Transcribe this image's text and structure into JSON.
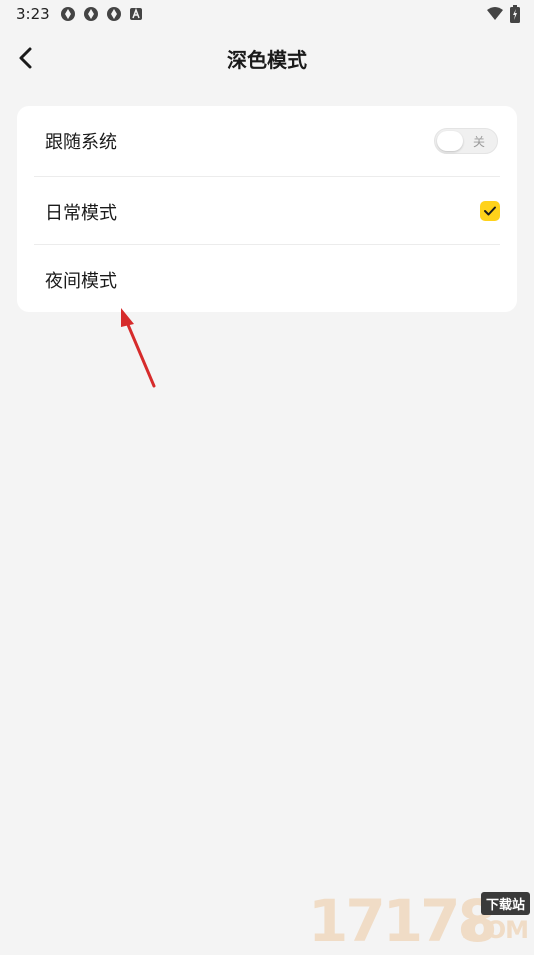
{
  "status_bar": {
    "time": "3:23",
    "left_icons": [
      "aperture-icon",
      "aperture-icon",
      "aperture-icon",
      "a-badge-icon"
    ],
    "right_icons": [
      "wifi-icon",
      "battery-charging-icon"
    ]
  },
  "header": {
    "back_icon": "chevron-left-icon",
    "title": "深色模式"
  },
  "settings": {
    "follow_system": {
      "label": "跟随系统",
      "toggle_text": "关",
      "on": false
    },
    "day_mode": {
      "label": "日常模式",
      "checked": true
    },
    "night_mode": {
      "label": "夜间模式",
      "checked": false
    }
  },
  "annotation": {
    "arrow_color": "#d62b2b",
    "points_to": "night-mode-row"
  },
  "watermark": {
    "number": "17178",
    "tag": "下载站",
    "domain": ".COM"
  },
  "colors": {
    "background": "#f4f4f4",
    "card": "#ffffff",
    "accent_yellow": "#ffd21a",
    "text": "#1a1a1a"
  }
}
